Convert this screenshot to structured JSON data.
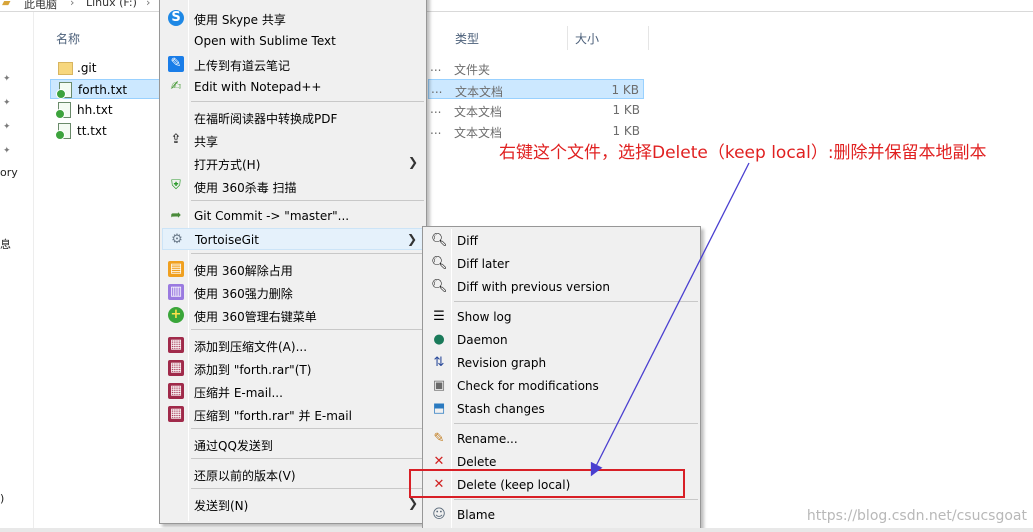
{
  "breadcrumb": {
    "parts": [
      "此电脑",
      "Linux (F:)"
    ]
  },
  "left_pane": {
    "cut_labels": [
      "ory",
      "息",
      ")"
    ]
  },
  "columns": {
    "name": "名称",
    "type": "类型",
    "size": "大小"
  },
  "files": [
    {
      "name": ".git",
      "dots": "...",
      "type": "文件夹",
      "size": ""
    },
    {
      "name": "forth.txt",
      "dots": "...",
      "type": "文本文档",
      "size": "1 KB"
    },
    {
      "name": "hh.txt",
      "dots": "...",
      "type": "文本文档",
      "size": "1 KB"
    },
    {
      "name": "tt.txt",
      "dots": "...",
      "type": "文本文档",
      "size": "1 KB"
    }
  ],
  "context_menu": {
    "items": [
      {
        "label": "使用 Skype 共享",
        "icon": "skype-icon"
      },
      {
        "label": "Open with Sublime Text",
        "icon": ""
      },
      {
        "label": "上传到有道云笔记",
        "icon": "youdao-note-icon"
      },
      {
        "label": "Edit with Notepad++",
        "icon": "notepad-plus-plus-icon"
      },
      {
        "label": "在福昕阅读器中转换成PDF",
        "icon": ""
      },
      {
        "label": "共享",
        "icon": "share-icon"
      },
      {
        "label": "打开方式(H)",
        "icon": ""
      },
      {
        "label": "使用 360杀毒 扫描",
        "icon": "360-antivirus-icon"
      },
      {
        "label": "Git Commit -> \"master\"...",
        "icon": "git-commit-icon"
      },
      {
        "label": "TortoiseGit",
        "icon": "tortoisegit-icon"
      },
      {
        "label": "使用 360解除占用",
        "icon": "360-unlock-icon"
      },
      {
        "label": "使用 360强力删除",
        "icon": "360-shred-icon"
      },
      {
        "label": "使用 360管理右键菜单",
        "icon": "360-menu-manager-icon"
      },
      {
        "label": "添加到压缩文件(A)...",
        "icon": "winrar-icon"
      },
      {
        "label": "添加到 \"forth.rar\"(T)",
        "icon": "winrar-icon"
      },
      {
        "label": "压缩并 E-mail...",
        "icon": "winrar-icon"
      },
      {
        "label": "压缩到 \"forth.rar\" 并 E-mail",
        "icon": "winrar-icon"
      },
      {
        "label": "通过QQ发送到",
        "icon": ""
      },
      {
        "label": "还原以前的版本(V)",
        "icon": ""
      },
      {
        "label": "发送到(N)",
        "icon": ""
      }
    ]
  },
  "tortoise_menu": {
    "items": [
      {
        "label": "Diff",
        "icon": "magnifier-icon"
      },
      {
        "label": "Diff later",
        "icon": "magnifier-icon"
      },
      {
        "label": "Diff with previous version",
        "icon": "magnifier-icon"
      },
      {
        "label": "Show log",
        "icon": "log-icon"
      },
      {
        "label": "Daemon",
        "icon": "globe-icon"
      },
      {
        "label": "Revision graph",
        "icon": "revision-graph-icon"
      },
      {
        "label": "Check for modifications",
        "icon": "check-modifications-icon"
      },
      {
        "label": "Stash changes",
        "icon": "stash-icon"
      },
      {
        "label": "Rename...",
        "icon": "rename-icon"
      },
      {
        "label": "Delete",
        "icon": "delete-icon"
      },
      {
        "label": "Delete (keep local)",
        "icon": "delete-icon"
      },
      {
        "label": "Blame",
        "icon": "blame-icon"
      }
    ]
  },
  "annotation": {
    "text": "右键这个文件，选择Delete（keep local）:删除并保留本地副本"
  },
  "watermark": "https://blog.csdn.net/csucsgoat",
  "colors": {
    "annotation": "#e02020",
    "highlight_box": "#d81f26",
    "arrow": "#4a3fd0",
    "selection": "#cce8ff"
  }
}
